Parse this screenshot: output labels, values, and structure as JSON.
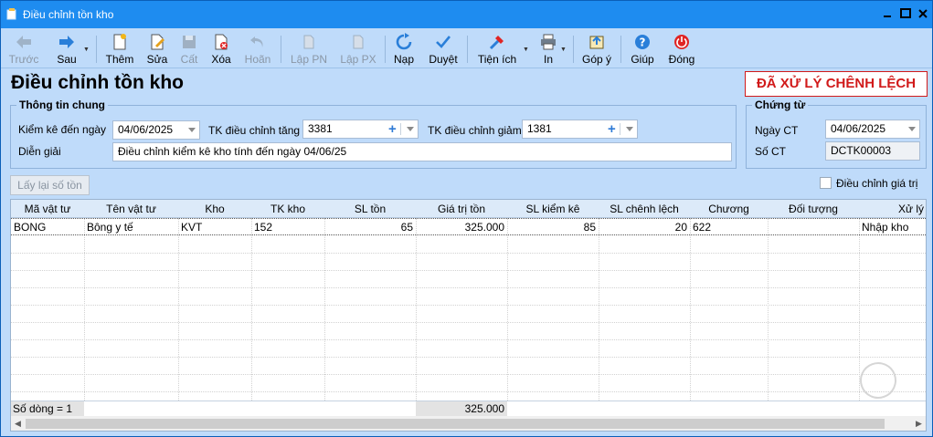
{
  "window": {
    "title": "Điều chỉnh tồn kho"
  },
  "toolbar": {
    "items": [
      {
        "label": "Trước",
        "icon": "arrow-left-icon",
        "enabled": false
      },
      {
        "label": "Sau",
        "icon": "arrow-right-icon",
        "enabled": true
      },
      {
        "label": "Thêm",
        "icon": "new-document-icon",
        "enabled": true
      },
      {
        "label": "Sửa",
        "icon": "edit-icon",
        "enabled": true
      },
      {
        "label": "Cất",
        "icon": "save-icon",
        "enabled": false
      },
      {
        "label": "Xóa",
        "icon": "delete-icon",
        "enabled": true
      },
      {
        "label": "Hoãn",
        "icon": "undo-icon",
        "enabled": false
      },
      {
        "label": "Lập PN",
        "icon": "create-receipt-icon",
        "enabled": false
      },
      {
        "label": "Lập PX",
        "icon": "create-issue-icon",
        "enabled": false
      },
      {
        "label": "Nạp",
        "icon": "refresh-icon",
        "enabled": true
      },
      {
        "label": "Duyệt",
        "icon": "check-icon",
        "enabled": true
      },
      {
        "label": "Tiện ích",
        "icon": "tools-icon",
        "enabled": true
      },
      {
        "label": "In",
        "icon": "printer-icon",
        "enabled": true
      },
      {
        "label": "Góp ý",
        "icon": "feedback-icon",
        "enabled": true
      },
      {
        "label": "Giúp",
        "icon": "help-icon",
        "enabled": true
      },
      {
        "label": "Đóng",
        "icon": "power-icon",
        "enabled": true
      }
    ]
  },
  "header": {
    "page_title": "Điều chỉnh tồn kho",
    "status_badge": "ĐÃ XỬ LÝ CHÊNH LỆCH"
  },
  "general_info": {
    "title": "Thông tin chung",
    "inventory_date_label": "Kiểm kê đến ngày",
    "inventory_date": "04/06/2025",
    "increase_account_label": "TK điều chỉnh tăng",
    "increase_account": "3381",
    "decrease_account_label": "TK điều chỉnh giảm",
    "decrease_account": "1381",
    "description_label": "Diễn giải",
    "description": "Điều chỉnh kiểm kê kho tính đến ngày 04/06/25"
  },
  "voucher": {
    "title": "Chứng từ",
    "date_label": "Ngày CT",
    "date": "04/06/2025",
    "number_label": "Số CT",
    "number": "DCTK00003"
  },
  "actions": {
    "recalc_label": "Lấy lại số tồn",
    "adjust_value_label": "Điều chỉnh giá trị"
  },
  "grid": {
    "columns": [
      "Mã vật tư",
      "Tên vật tư",
      "Kho",
      "TK kho",
      "SL tồn",
      "Giá trị tồn",
      "SL kiểm kê",
      "SL chênh lệch",
      "Chương",
      "Đối tượng",
      "Xử lý"
    ],
    "rows": [
      {
        "code": "BONG",
        "name": "Bông y tế",
        "warehouse": "KVT",
        "account": "152",
        "qty_stock": "65",
        "value_stock": "325.000",
        "qty_count": "85",
        "qty_diff": "20",
        "chapter": "622",
        "object": "",
        "action": "Nhập kho"
      }
    ],
    "footer_count": "Số dòng = 1",
    "footer_sum": "325.000"
  },
  "colors": {
    "accent": "#1e8cf0",
    "background": "#bfdbfa",
    "badge": "#d11a1a"
  }
}
